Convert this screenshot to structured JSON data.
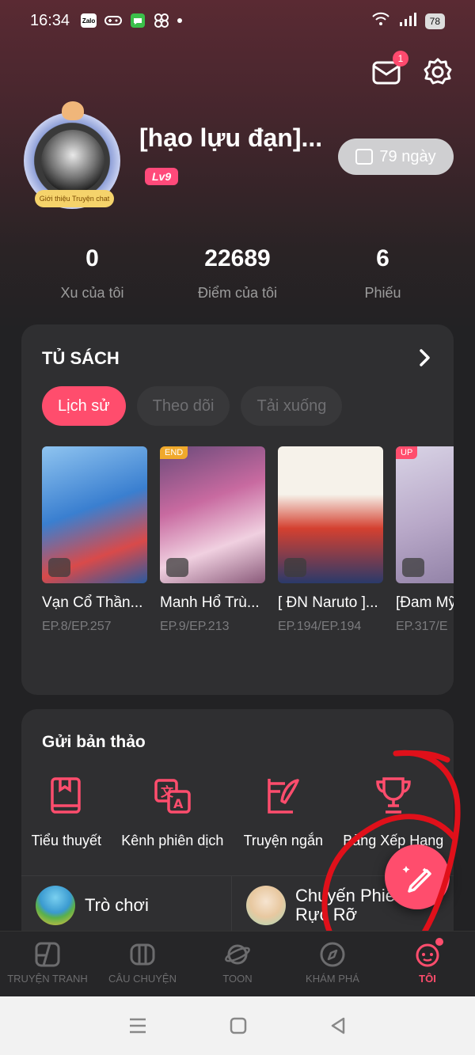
{
  "status_bar": {
    "time": "16:34",
    "battery": "78",
    "notification_icons": [
      "zalo-icon",
      "gamepad-icon",
      "messages-icon",
      "app-icon"
    ]
  },
  "header": {
    "mail_badge": "1",
    "icons": [
      "mail-icon",
      "settings-icon"
    ]
  },
  "profile": {
    "username": "[hạo lựu đạn]...",
    "level": "Lv9",
    "days": "79 ngày",
    "avatar_caption": "Giới thiệu Truyện chat"
  },
  "stats": [
    {
      "value": "0",
      "label": "Xu của tôi"
    },
    {
      "value": "22689",
      "label": "Điểm của tôi"
    },
    {
      "value": "6",
      "label": "Phiếu"
    }
  ],
  "library": {
    "title": "TỦ SÁCH",
    "tabs": [
      "Lịch sử",
      "Theo dõi",
      "Tải xuống"
    ],
    "active_tab": "Lịch sử",
    "books": [
      {
        "title": "Vạn Cổ Thần...",
        "episode": "EP.8/EP.257",
        "tag": "",
        "cover_colors": [
          "#3a7fd0",
          "#8fc4f0",
          "#d94a4a"
        ]
      },
      {
        "title": "Manh Hổ Trù...",
        "episode": "EP.9/EP.213",
        "tag": "END",
        "cover_colors": [
          "#c86aa0",
          "#f0d0e0",
          "#6a4a7a"
        ]
      },
      {
        "title": "[ ĐN Naruto ]...",
        "episode": "EP.194/EP.194",
        "tag": "",
        "cover_colors": [
          "#f6f2ea",
          "#d44030",
          "#2a3a6a"
        ]
      },
      {
        "title": "[Đam Mỹ",
        "episode": "EP.317/E",
        "tag": "UP",
        "cover_colors": [
          "#d9d4e6",
          "#b8a8c8",
          "#8a7aa0"
        ]
      }
    ]
  },
  "submit": {
    "title": "Gửi bản thảo",
    "tools": [
      {
        "label": "Tiểu thuyết",
        "icon": "book-icon"
      },
      {
        "label": "Kênh phiên dịch",
        "icon": "translate-icon"
      },
      {
        "label": "Truyện ngắn",
        "icon": "quill-icon"
      },
      {
        "label": "Bảng Xếp Hạng",
        "icon": "trophy-icon"
      }
    ]
  },
  "extras": [
    {
      "label": "Trò chơi",
      "icon": "game-thumb-icon"
    },
    {
      "label": "Chuyến Phiêu Lưu Rực Rỡ",
      "icon": "cat-girl-thumb-icon"
    }
  ],
  "bottom_nav": [
    {
      "label": "TRUYỆN TRANH",
      "icon": "comic-icon",
      "active": false
    },
    {
      "label": "CÂU CHUYỆN",
      "icon": "story-icon",
      "active": false
    },
    {
      "label": "TOON",
      "icon": "planet-icon",
      "active": false
    },
    {
      "label": "KHÁM PHÁ",
      "icon": "compass-icon",
      "active": false
    },
    {
      "label": "TÔI",
      "icon": "me-icon",
      "active": true
    }
  ],
  "colors": {
    "accent": "#ff4d6d",
    "background": "#222224",
    "card": "#2f2f31"
  }
}
